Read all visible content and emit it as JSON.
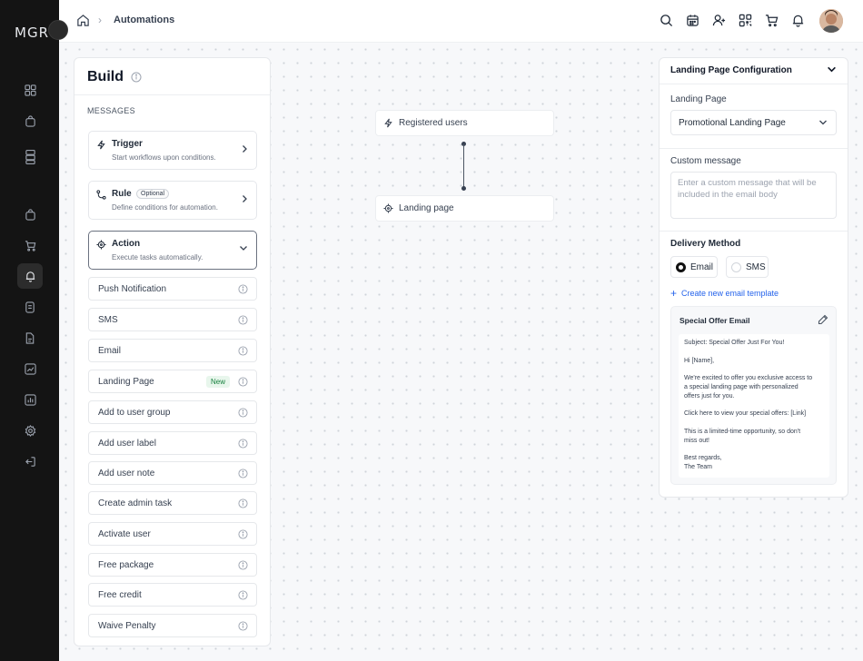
{
  "app": {
    "logo": "MGR"
  },
  "breadcrumb": {
    "title": "Automations"
  },
  "build": {
    "title": "Build",
    "section_label": "MESSAGES",
    "steps": [
      {
        "title": "Trigger",
        "desc": "Start workflows upon conditions."
      },
      {
        "title": "Rule",
        "badge": "Optional",
        "desc": "Define conditions for automation."
      },
      {
        "title": "Action",
        "desc": "Execute tasks automatically."
      }
    ],
    "actions": [
      {
        "label": "Push Notification"
      },
      {
        "label": "SMS"
      },
      {
        "label": "Email"
      },
      {
        "label": "Landing Page",
        "badge": "New"
      },
      {
        "label": "Add to user group"
      },
      {
        "label": "Add user label"
      },
      {
        "label": "Add user note"
      },
      {
        "label": "Create admin task"
      },
      {
        "label": "Activate user"
      },
      {
        "label": "Free package"
      },
      {
        "label": "Free credit"
      },
      {
        "label": "Waive Penalty"
      }
    ]
  },
  "flow": {
    "nodes": [
      {
        "label": "Registered users",
        "icon": "lightning-icon"
      },
      {
        "label": "Landing page",
        "icon": "target-icon"
      }
    ]
  },
  "config": {
    "title": "Landing Page Configuration",
    "landing_page_label": "Landing Page",
    "landing_page_value": "Promotional Landing Page",
    "custom_message_label": "Custom message",
    "custom_message_placeholder": "Enter a custom message that will be included in the email body",
    "delivery_method_label": "Delivery Method",
    "delivery_options": [
      {
        "label": "Email",
        "selected": true
      },
      {
        "label": "SMS",
        "selected": false
      }
    ],
    "create_template_label": "Create new email template",
    "template": {
      "title": "Special Offer Email",
      "lines": [
        "Subject: Special Offer Just For You!",
        "",
        "Hi [Name],",
        "",
        "We're excited to offer you exclusive access to",
        "a special landing page with personalized",
        "offers just for you.",
        "",
        "Click here to view your special offers: [Link]",
        "",
        "This is a limited-time opportunity, so don't",
        "miss out!",
        "",
        "Best regards,",
        "The Team"
      ]
    }
  },
  "colors": {
    "sidebar": "#141414",
    "accent_link": "#2563eb",
    "new_badge": "#15803d"
  }
}
